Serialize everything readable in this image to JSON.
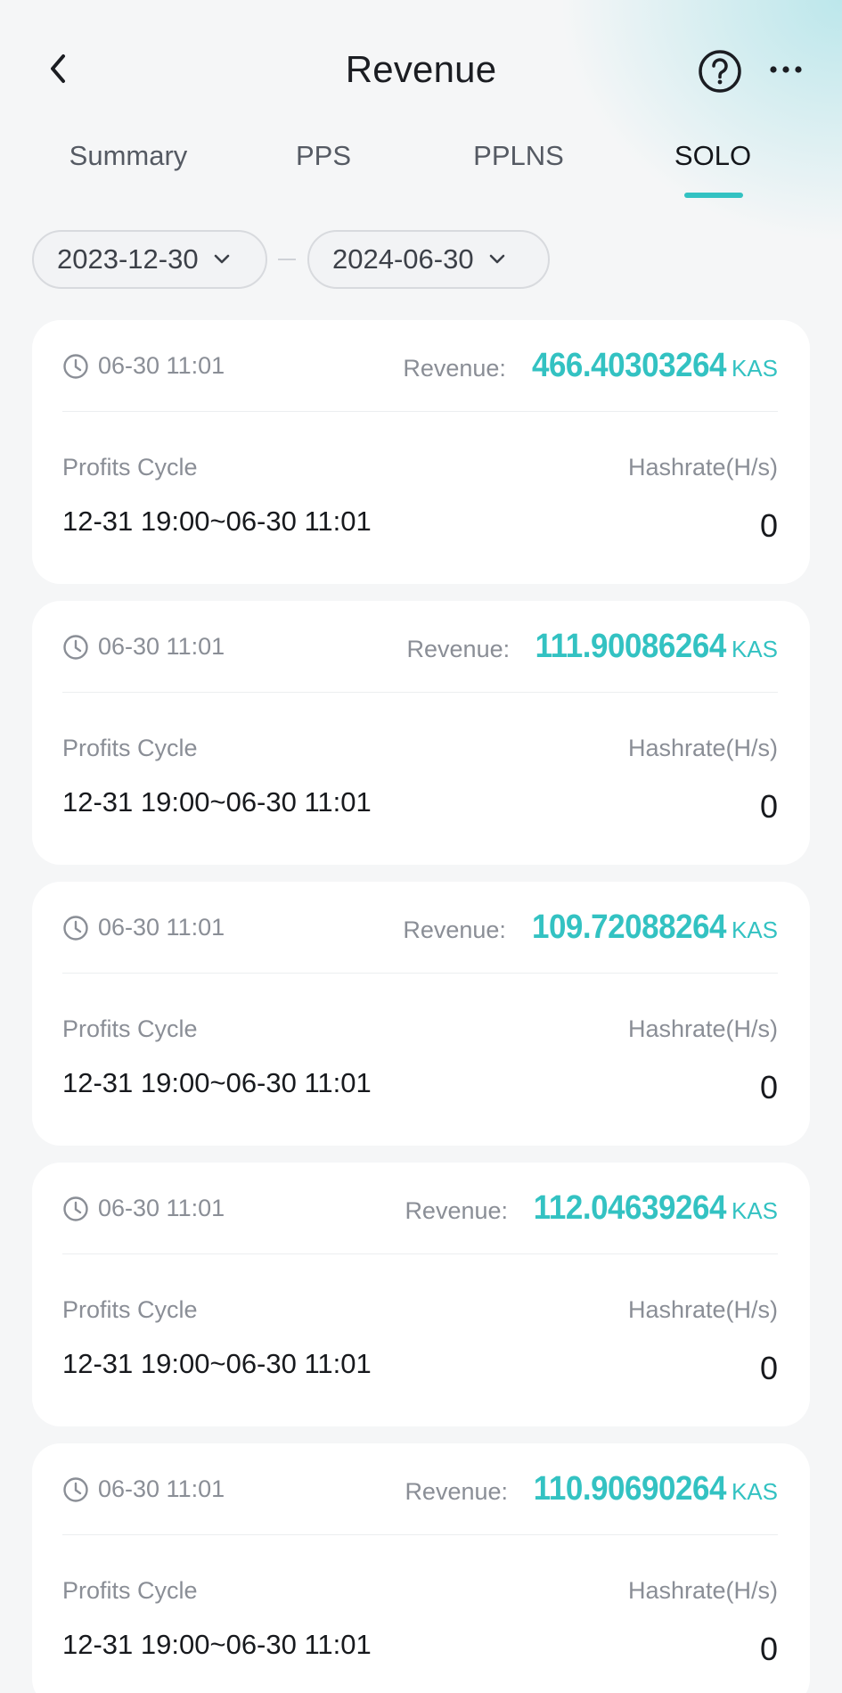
{
  "header": {
    "title": "Revenue",
    "back_icon": "chevron-left-icon",
    "help_icon": "question-circle-icon",
    "more_icon": "ellipsis-icon"
  },
  "tabs": [
    {
      "label": "Summary",
      "active": false
    },
    {
      "label": "PPS",
      "active": false
    },
    {
      "label": "PPLNS",
      "active": false
    },
    {
      "label": "SOLO",
      "active": true
    }
  ],
  "filters": {
    "start_date": "2023-12-30",
    "end_date": "2024-06-30"
  },
  "colors": {
    "accent": "#33c2c2"
  },
  "records": [
    {
      "time": "06-30 11:01",
      "revenue_label": "Revenue:",
      "revenue": "466.40303264",
      "unit": "KAS",
      "cycle_label": "Profits Cycle",
      "cycle": "12-31 19:00~06-30 11:01",
      "hashrate_label": "Hashrate(H/s)",
      "hashrate": "0"
    },
    {
      "time": "06-30 11:01",
      "revenue_label": "Revenue:",
      "revenue": "111.90086264",
      "unit": "KAS",
      "cycle_label": "Profits Cycle",
      "cycle": "12-31 19:00~06-30 11:01",
      "hashrate_label": "Hashrate(H/s)",
      "hashrate": "0"
    },
    {
      "time": "06-30 11:01",
      "revenue_label": "Revenue:",
      "revenue": "109.72088264",
      "unit": "KAS",
      "cycle_label": "Profits Cycle",
      "cycle": "12-31 19:00~06-30 11:01",
      "hashrate_label": "Hashrate(H/s)",
      "hashrate": "0"
    },
    {
      "time": "06-30 11:01",
      "revenue_label": "Revenue:",
      "revenue": "112.04639264",
      "unit": "KAS",
      "cycle_label": "Profits Cycle",
      "cycle": "12-31 19:00~06-30 11:01",
      "hashrate_label": "Hashrate(H/s)",
      "hashrate": "0"
    },
    {
      "time": "06-30 11:01",
      "revenue_label": "Revenue:",
      "revenue": "110.90690264",
      "unit": "KAS",
      "cycle_label": "Profits Cycle",
      "cycle": "12-31 19:00~06-30 11:01",
      "hashrate_label": "Hashrate(H/s)",
      "hashrate": "0"
    }
  ]
}
